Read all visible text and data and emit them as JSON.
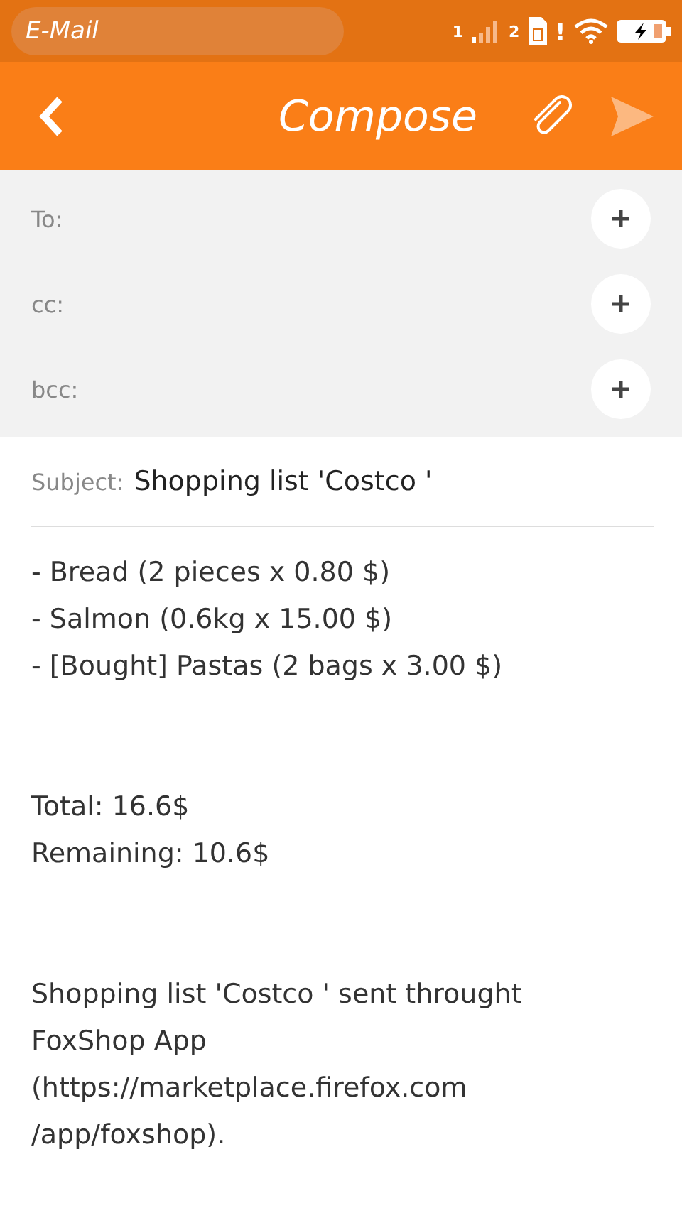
{
  "status_bar": {
    "notification": "E-Mail",
    "sim1": "1",
    "sim2": "2",
    "alert": "!"
  },
  "header": {
    "title": "Compose",
    "send_disabled": true
  },
  "recipients": [
    {
      "label": "To:"
    },
    {
      "label": "cc:"
    },
    {
      "label": "bcc:"
    }
  ],
  "subject": {
    "label": "Subject:",
    "value": "Shopping list 'Costco '"
  },
  "body": [
    [
      "- Bread (2 pieces x 0.80 $)",
      "- Salmon (0.6kg x 15.00 $)",
      "- [Bought] Pastas (2 bags x 3.00 $)"
    ],
    [
      "Total: 16.6$",
      "Remaining: 10.6$"
    ],
    [
      "Shopping list 'Costco ' sent throught",
      "FoxShop App",
      "(https://marketplace.firefox.com",
      "/app/foxshop)."
    ]
  ]
}
